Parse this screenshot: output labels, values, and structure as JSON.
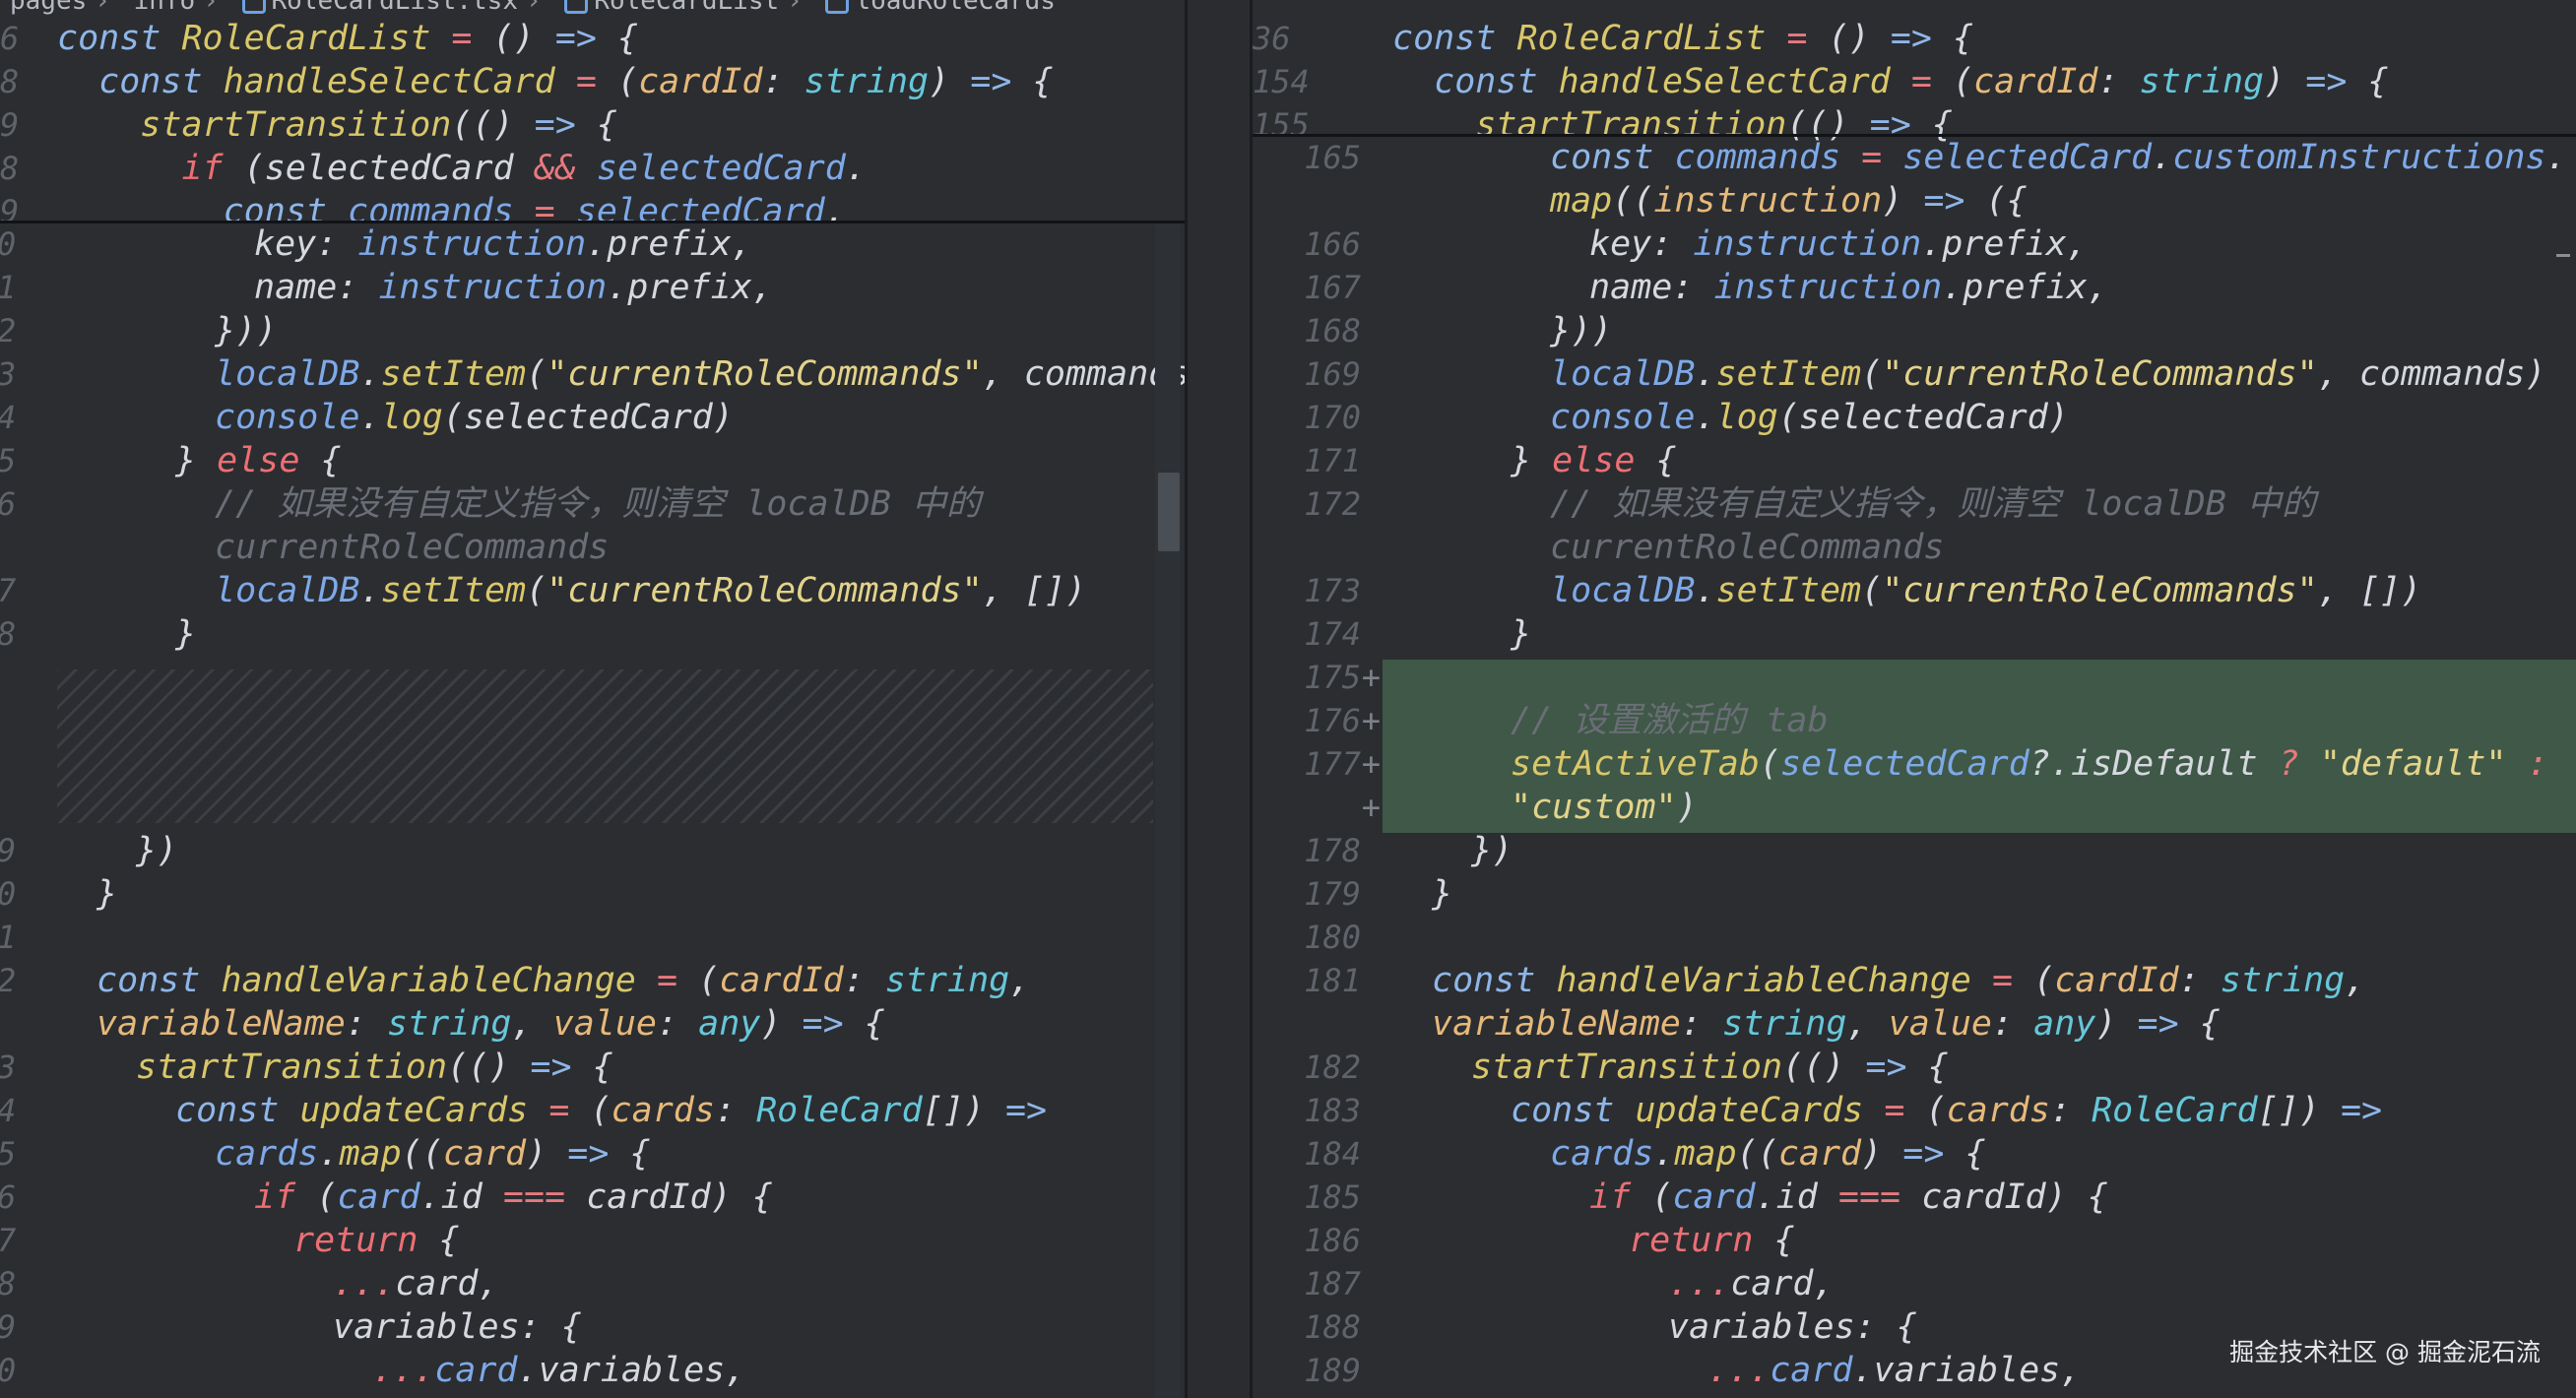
{
  "breadcrumb": [
    "pages",
    "info",
    "RoleCardList.tsx",
    "RoleCardList",
    "loadRoleCards"
  ],
  "left": {
    "sticky": [
      {
        "ln": "6",
        "html": "<span class='kw'>const</span> <span class='fn'>RoleCardList</span> <span class='op'>=</span> () <span class='kw'>=&gt;</span> {"
      },
      {
        "ln": "8",
        "html": "  <span class='kw'>const</span> <span class='fn'>handleSelectCard</span> <span class='op'>=</span> (<span class='pm'>cardId</span>: <span class='ty'>string</span>) <span class='kw'>=&gt;</span> {"
      },
      {
        "ln": "9",
        "html": "    <span class='fn'>startTransition</span>(() <span class='kw'>=&gt;</span> {"
      },
      {
        "ln": "8",
        "html": "      <span class='kr'>if</span> (selectedCard <span class='op'>&amp;&amp;</span> <span class='pr'>selectedCard</span>."
      },
      {
        "ln": "9",
        "html": "        <span class='kw'>const</span> <span class='pr'>commands</span> <span class='op'>=</span> <span class='pr'>selectedCard</span>."
      }
    ],
    "lines": [
      {
        "ln": "0",
        "indent": 5,
        "html": "key: <span class='pr'>instruction</span>.prefix,"
      },
      {
        "ln": "1",
        "indent": 5,
        "html": "name: <span class='pr'>instruction</span>.prefix,"
      },
      {
        "ln": "2",
        "indent": 4,
        "html": "}))"
      },
      {
        "ln": "3",
        "indent": 4,
        "html": "<span class='pr'>localDB</span>.<span class='fn'>setItem</span>(<span class='st'>\"currentRoleCommands\"</span>, commands)"
      },
      {
        "ln": "4",
        "indent": 4,
        "html": "<span class='pr'>console</span>.<span class='fn'>log</span>(selectedCard)"
      },
      {
        "ln": "5",
        "indent": 3,
        "html": "} <span class='kr'>else</span> {"
      },
      {
        "ln": "6",
        "indent": 4,
        "html": "<span class='cm'>// 如果没有自定义指令，则清空 localDB 中的</span>"
      },
      {
        "ln": "",
        "indent": 4,
        "html": "<span class='cm'>currentRoleCommands</span>"
      },
      {
        "ln": "7",
        "indent": 4,
        "html": "<span class='pr'>localDB</span>.<span class='fn'>setItem</span>(<span class='st'>\"currentRoleCommands\"</span>, [])"
      },
      {
        "ln": "8",
        "indent": 3,
        "html": "}"
      },
      {
        "ln": "",
        "indent": 0,
        "html": ""
      },
      {
        "ln": "",
        "indent": 0,
        "html": ""
      },
      {
        "ln": "",
        "indent": 0,
        "html": ""
      },
      {
        "ln": "",
        "indent": 0,
        "html": ""
      },
      {
        "ln": "9",
        "indent": 2,
        "html": "})"
      },
      {
        "ln": "0",
        "indent": 1,
        "html": "}"
      },
      {
        "ln": "1",
        "indent": 0,
        "html": ""
      },
      {
        "ln": "2",
        "indent": 1,
        "html": "<span class='kw'>const</span> <span class='fn'>handleVariableChange</span> <span class='op'>=</span> (<span class='pm'>cardId</span>: <span class='ty'>string</span>,"
      },
      {
        "ln": "",
        "indent": 1,
        "html": "<span class='pm'>variableName</span>: <span class='ty'>string</span>, <span class='pm'>value</span>: <span class='ty'>any</span>) <span class='kw'>=&gt;</span> {"
      },
      {
        "ln": "3",
        "indent": 2,
        "html": "<span class='fn'>startTransition</span>(() <span class='kw'>=&gt;</span> {"
      },
      {
        "ln": "4",
        "indent": 3,
        "html": "<span class='kw'>const</span> <span class='fn'>updateCards</span> <span class='op'>=</span> (<span class='pm'>cards</span>: <span class='ty'>RoleCard</span>[]) <span class='kw'>=&gt;</span>"
      },
      {
        "ln": "5",
        "indent": 4,
        "html": "<span class='pr'>cards</span>.<span class='fn'>map</span>((<span class='pm'>card</span>) <span class='kw'>=&gt;</span> {"
      },
      {
        "ln": "6",
        "indent": 5,
        "html": "<span class='kr'>if</span> (<span class='pr'>card</span>.id <span class='op'>===</span> cardId) {"
      },
      {
        "ln": "7",
        "indent": 6,
        "html": "<span class='kr'>return</span> {"
      },
      {
        "ln": "8",
        "indent": 7,
        "html": "<span class='op'>...</span>card,"
      },
      {
        "ln": "9",
        "indent": 7,
        "html": "variables: {"
      },
      {
        "ln": "0",
        "indent": 8,
        "html": "<span class='op'>...</span><span class='pr'>card</span>.variables,"
      }
    ]
  },
  "right": {
    "sticky": [
      {
        "ln": "36",
        "html": "<span class='kw'>const</span> <span class='fn'>RoleCardList</span> <span class='op'>=</span> () <span class='kw'>=&gt;</span> {"
      },
      {
        "ln": "154",
        "html": "  <span class='kw'>const</span> <span class='fn'>handleSelectCard</span> <span class='op'>=</span> (<span class='pm'>cardId</span>: <span class='ty'>string</span>) <span class='kw'>=&gt;</span> {"
      },
      {
        "ln": "155",
        "html": "    <span class='fn'>startTransition</span>(() <span class='kw'>=&gt;</span> {"
      }
    ],
    "lines": [
      {
        "ln": "165",
        "indent": 4,
        "added": false,
        "html": "<span class='kw'>const</span> <span class='pr'>commands</span> <span class='op'>=</span> <span class='pr'>selectedCard</span>.<span class='pr'>customInstructions</span>."
      },
      {
        "ln": "",
        "indent": 4,
        "added": false,
        "html": "<span class='fn'>map</span>((<span class='pm'>instruction</span>) <span class='kw'>=&gt;</span> ({"
      },
      {
        "ln": "166",
        "indent": 5,
        "added": false,
        "html": "key: <span class='pr'>instruction</span>.prefix,"
      },
      {
        "ln": "167",
        "indent": 5,
        "added": false,
        "html": "name: <span class='pr'>instruction</span>.prefix,"
      },
      {
        "ln": "168",
        "indent": 4,
        "added": false,
        "html": "}))"
      },
      {
        "ln": "169",
        "indent": 4,
        "added": false,
        "html": "<span class='pr'>localDB</span>.<span class='fn'>setItem</span>(<span class='st'>\"currentRoleCommands\"</span>, commands)"
      },
      {
        "ln": "170",
        "indent": 4,
        "added": false,
        "html": "<span class='pr'>console</span>.<span class='fn'>log</span>(selectedCard)"
      },
      {
        "ln": "171",
        "indent": 3,
        "added": false,
        "html": "} <span class='kr'>else</span> {"
      },
      {
        "ln": "172",
        "indent": 4,
        "added": false,
        "html": "<span class='cm'>// 如果没有自定义指令，则清空 localDB 中的</span>"
      },
      {
        "ln": "",
        "indent": 4,
        "added": false,
        "html": "<span class='cm'>currentRoleCommands</span>"
      },
      {
        "ln": "173",
        "indent": 4,
        "added": false,
        "html": "<span class='pr'>localDB</span>.<span class='fn'>setItem</span>(<span class='st'>\"currentRoleCommands\"</span>, [])"
      },
      {
        "ln": "174",
        "indent": 3,
        "added": false,
        "html": "}"
      },
      {
        "ln": "175",
        "plus": "+",
        "indent": 3,
        "added": true,
        "html": ""
      },
      {
        "ln": "176",
        "plus": "+",
        "indent": 3,
        "added": true,
        "html": "<span class='cm'>// 设置激活的 tab</span>"
      },
      {
        "ln": "177",
        "plus": "+",
        "indent": 3,
        "added": true,
        "html": "<span class='fn'>setActiveTab</span>(<span class='pr'>selectedCard</span>?.isDefault <span class='op'>?</span> <span class='st'>\"default\"</span> <span class='op'>:</span>"
      },
      {
        "ln": "",
        "plus": "+",
        "indent": 3,
        "added": true,
        "html": "<span class='st'>\"custom\"</span>)"
      },
      {
        "ln": "178",
        "indent": 2,
        "added": false,
        "html": "})"
      },
      {
        "ln": "179",
        "indent": 1,
        "added": false,
        "html": "}"
      },
      {
        "ln": "180",
        "indent": 0,
        "added": false,
        "html": ""
      },
      {
        "ln": "181",
        "indent": 1,
        "added": false,
        "html": "<span class='kw'>const</span> <span class='fn'>handleVariableChange</span> <span class='op'>=</span> (<span class='pm'>cardId</span>: <span class='ty'>string</span>,"
      },
      {
        "ln": "",
        "indent": 1,
        "added": false,
        "html": "<span class='pm'>variableName</span>: <span class='ty'>string</span>, <span class='pm'>value</span>: <span class='ty'>any</span>) <span class='kw'>=&gt;</span> {"
      },
      {
        "ln": "182",
        "indent": 2,
        "added": false,
        "html": "<span class='fn'>startTransition</span>(() <span class='kw'>=&gt;</span> {"
      },
      {
        "ln": "183",
        "indent": 3,
        "added": false,
        "html": "<span class='kw'>const</span> <span class='fn'>updateCards</span> <span class='op'>=</span> (<span class='pm'>cards</span>: <span class='ty'>RoleCard</span>[]) <span class='kw'>=&gt;</span>"
      },
      {
        "ln": "184",
        "indent": 4,
        "added": false,
        "html": "<span class='pr'>cards</span>.<span class='fn'>map</span>((<span class='pm'>card</span>) <span class='kw'>=&gt;</span> {"
      },
      {
        "ln": "185",
        "indent": 5,
        "added": false,
        "html": "<span class='kr'>if</span> (<span class='pr'>card</span>.id <span class='op'>===</span> cardId) {"
      },
      {
        "ln": "186",
        "indent": 6,
        "added": false,
        "html": "<span class='kr'>return</span> {"
      },
      {
        "ln": "187",
        "indent": 7,
        "added": false,
        "html": "<span class='op'>...</span>card,"
      },
      {
        "ln": "188",
        "indent": 7,
        "added": false,
        "html": "variables: {"
      },
      {
        "ln": "189",
        "indent": 8,
        "added": false,
        "html": "<span class='op'>...</span><span class='pr'>card</span>.variables,"
      }
    ]
  },
  "watermark": "掘金技术社区 @ 掘金泥石流"
}
